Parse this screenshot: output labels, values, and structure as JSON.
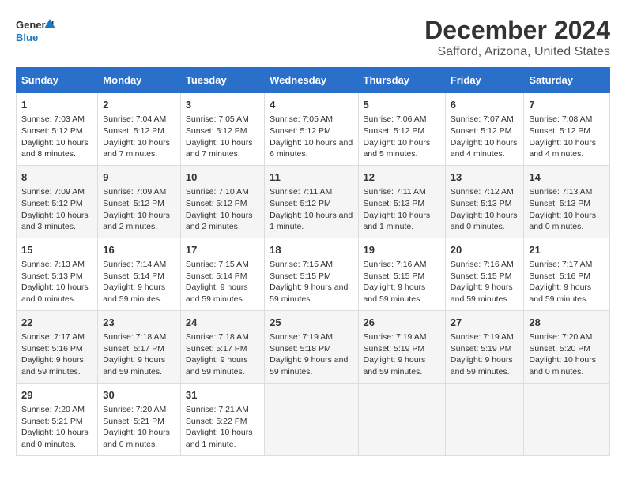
{
  "logo": {
    "line1": "General",
    "line2": "Blue"
  },
  "title": "December 2024",
  "subtitle": "Safford, Arizona, United States",
  "days_header": [
    "Sunday",
    "Monday",
    "Tuesday",
    "Wednesday",
    "Thursday",
    "Friday",
    "Saturday"
  ],
  "weeks": [
    [
      {
        "day": "1",
        "sunrise": "Sunrise: 7:03 AM",
        "sunset": "Sunset: 5:12 PM",
        "daylight": "Daylight: 10 hours and 8 minutes."
      },
      {
        "day": "2",
        "sunrise": "Sunrise: 7:04 AM",
        "sunset": "Sunset: 5:12 PM",
        "daylight": "Daylight: 10 hours and 7 minutes."
      },
      {
        "day": "3",
        "sunrise": "Sunrise: 7:05 AM",
        "sunset": "Sunset: 5:12 PM",
        "daylight": "Daylight: 10 hours and 7 minutes."
      },
      {
        "day": "4",
        "sunrise": "Sunrise: 7:05 AM",
        "sunset": "Sunset: 5:12 PM",
        "daylight": "Daylight: 10 hours and 6 minutes."
      },
      {
        "day": "5",
        "sunrise": "Sunrise: 7:06 AM",
        "sunset": "Sunset: 5:12 PM",
        "daylight": "Daylight: 10 hours and 5 minutes."
      },
      {
        "day": "6",
        "sunrise": "Sunrise: 7:07 AM",
        "sunset": "Sunset: 5:12 PM",
        "daylight": "Daylight: 10 hours and 4 minutes."
      },
      {
        "day": "7",
        "sunrise": "Sunrise: 7:08 AM",
        "sunset": "Sunset: 5:12 PM",
        "daylight": "Daylight: 10 hours and 4 minutes."
      }
    ],
    [
      {
        "day": "8",
        "sunrise": "Sunrise: 7:09 AM",
        "sunset": "Sunset: 5:12 PM",
        "daylight": "Daylight: 10 hours and 3 minutes."
      },
      {
        "day": "9",
        "sunrise": "Sunrise: 7:09 AM",
        "sunset": "Sunset: 5:12 PM",
        "daylight": "Daylight: 10 hours and 2 minutes."
      },
      {
        "day": "10",
        "sunrise": "Sunrise: 7:10 AM",
        "sunset": "Sunset: 5:12 PM",
        "daylight": "Daylight: 10 hours and 2 minutes."
      },
      {
        "day": "11",
        "sunrise": "Sunrise: 7:11 AM",
        "sunset": "Sunset: 5:12 PM",
        "daylight": "Daylight: 10 hours and 1 minute."
      },
      {
        "day": "12",
        "sunrise": "Sunrise: 7:11 AM",
        "sunset": "Sunset: 5:13 PM",
        "daylight": "Daylight: 10 hours and 1 minute."
      },
      {
        "day": "13",
        "sunrise": "Sunrise: 7:12 AM",
        "sunset": "Sunset: 5:13 PM",
        "daylight": "Daylight: 10 hours and 0 minutes."
      },
      {
        "day": "14",
        "sunrise": "Sunrise: 7:13 AM",
        "sunset": "Sunset: 5:13 PM",
        "daylight": "Daylight: 10 hours and 0 minutes."
      }
    ],
    [
      {
        "day": "15",
        "sunrise": "Sunrise: 7:13 AM",
        "sunset": "Sunset: 5:13 PM",
        "daylight": "Daylight: 10 hours and 0 minutes."
      },
      {
        "day": "16",
        "sunrise": "Sunrise: 7:14 AM",
        "sunset": "Sunset: 5:14 PM",
        "daylight": "Daylight: 9 hours and 59 minutes."
      },
      {
        "day": "17",
        "sunrise": "Sunrise: 7:15 AM",
        "sunset": "Sunset: 5:14 PM",
        "daylight": "Daylight: 9 hours and 59 minutes."
      },
      {
        "day": "18",
        "sunrise": "Sunrise: 7:15 AM",
        "sunset": "Sunset: 5:15 PM",
        "daylight": "Daylight: 9 hours and 59 minutes."
      },
      {
        "day": "19",
        "sunrise": "Sunrise: 7:16 AM",
        "sunset": "Sunset: 5:15 PM",
        "daylight": "Daylight: 9 hours and 59 minutes."
      },
      {
        "day": "20",
        "sunrise": "Sunrise: 7:16 AM",
        "sunset": "Sunset: 5:15 PM",
        "daylight": "Daylight: 9 hours and 59 minutes."
      },
      {
        "day": "21",
        "sunrise": "Sunrise: 7:17 AM",
        "sunset": "Sunset: 5:16 PM",
        "daylight": "Daylight: 9 hours and 59 minutes."
      }
    ],
    [
      {
        "day": "22",
        "sunrise": "Sunrise: 7:17 AM",
        "sunset": "Sunset: 5:16 PM",
        "daylight": "Daylight: 9 hours and 59 minutes."
      },
      {
        "day": "23",
        "sunrise": "Sunrise: 7:18 AM",
        "sunset": "Sunset: 5:17 PM",
        "daylight": "Daylight: 9 hours and 59 minutes."
      },
      {
        "day": "24",
        "sunrise": "Sunrise: 7:18 AM",
        "sunset": "Sunset: 5:17 PM",
        "daylight": "Daylight: 9 hours and 59 minutes."
      },
      {
        "day": "25",
        "sunrise": "Sunrise: 7:19 AM",
        "sunset": "Sunset: 5:18 PM",
        "daylight": "Daylight: 9 hours and 59 minutes."
      },
      {
        "day": "26",
        "sunrise": "Sunrise: 7:19 AM",
        "sunset": "Sunset: 5:19 PM",
        "daylight": "Daylight: 9 hours and 59 minutes."
      },
      {
        "day": "27",
        "sunrise": "Sunrise: 7:19 AM",
        "sunset": "Sunset: 5:19 PM",
        "daylight": "Daylight: 9 hours and 59 minutes."
      },
      {
        "day": "28",
        "sunrise": "Sunrise: 7:20 AM",
        "sunset": "Sunset: 5:20 PM",
        "daylight": "Daylight: 10 hours and 0 minutes."
      }
    ],
    [
      {
        "day": "29",
        "sunrise": "Sunrise: 7:20 AM",
        "sunset": "Sunset: 5:21 PM",
        "daylight": "Daylight: 10 hours and 0 minutes."
      },
      {
        "day": "30",
        "sunrise": "Sunrise: 7:20 AM",
        "sunset": "Sunset: 5:21 PM",
        "daylight": "Daylight: 10 hours and 0 minutes."
      },
      {
        "day": "31",
        "sunrise": "Sunrise: 7:21 AM",
        "sunset": "Sunset: 5:22 PM",
        "daylight": "Daylight: 10 hours and 1 minute."
      },
      {
        "day": "",
        "sunrise": "",
        "sunset": "",
        "daylight": ""
      },
      {
        "day": "",
        "sunrise": "",
        "sunset": "",
        "daylight": ""
      },
      {
        "day": "",
        "sunrise": "",
        "sunset": "",
        "daylight": ""
      },
      {
        "day": "",
        "sunrise": "",
        "sunset": "",
        "daylight": ""
      }
    ]
  ]
}
